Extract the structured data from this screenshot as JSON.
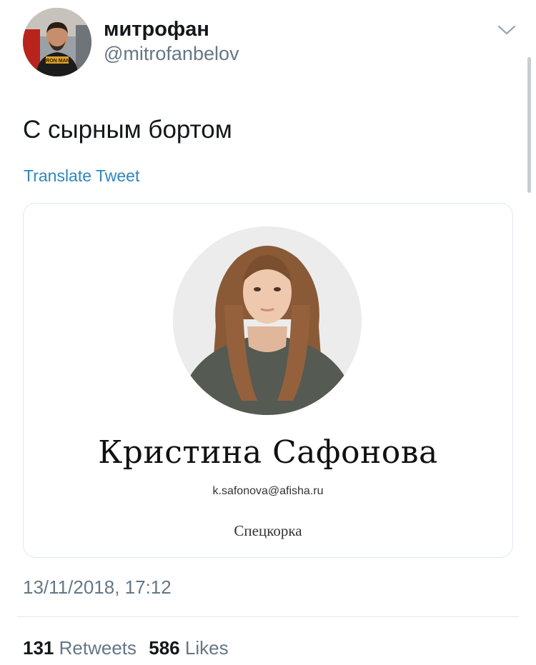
{
  "author": {
    "display_name": "митрофан",
    "handle": "@mitrofanbelov",
    "avatar_icon": "user-avatar",
    "shirt_text": "IRON MAN"
  },
  "menu_icon": "chevron-down-icon",
  "tweet": {
    "text": "С сырным бортом",
    "translate_label": "Translate Tweet"
  },
  "media": {
    "card_name": "Кристина Сафонова",
    "card_email": "k.safonova@afisha.ru",
    "card_role": "Спецкорка"
  },
  "timestamp": "13/11/2018, 17:12",
  "stats": {
    "retweets_count": "131",
    "retweets_label": "Retweets",
    "likes_count": "586",
    "likes_label": "Likes"
  },
  "colors": {
    "text": "#14171a",
    "secondary": "#657786",
    "link": "#2f86bd",
    "border": "#e1e8ed"
  }
}
